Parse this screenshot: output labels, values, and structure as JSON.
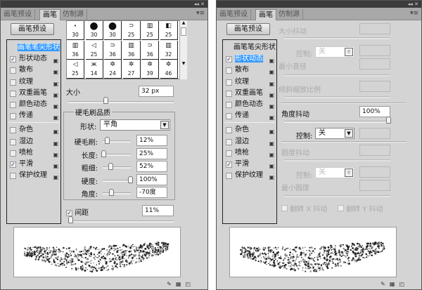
{
  "tabs": [
    "画笔预设",
    "画笔",
    "仿制源"
  ],
  "preset_button": "画笔预设",
  "list_items": [
    {
      "label": "画笔笔尖形状",
      "type": "head"
    },
    {
      "label": "形状动态",
      "checked": true
    },
    {
      "label": "散布",
      "checked": false
    },
    {
      "label": "纹理",
      "checked": false
    },
    {
      "label": "双重画笔",
      "checked": false
    },
    {
      "label": "颜色动态",
      "checked": false
    },
    {
      "label": "传递",
      "checked": false
    },
    {
      "label": "杂色",
      "checked": false
    },
    {
      "label": "湿边",
      "checked": false
    },
    {
      "label": "喷枪",
      "checked": false
    },
    {
      "label": "平滑",
      "checked": true
    },
    {
      "label": "保护纹理",
      "checked": false
    }
  ],
  "check_mark": "✓",
  "lock_glyph": "🔒",
  "brush_sizes": [
    "30",
    "30",
    "30",
    "25",
    "25",
    "25",
    "36",
    "25",
    "36",
    "36",
    "36",
    "32",
    "25",
    "14",
    "24",
    "27",
    "39",
    "46"
  ],
  "left": {
    "size_label": "大小",
    "size_value": "32 px",
    "size_pct": 0.35,
    "group_title": "硬毛刷品质",
    "shape_label": "形状:",
    "shape_value": "平角",
    "rows": [
      {
        "label": "硬毛刷:",
        "value": "12%",
        "pct": 0.12
      },
      {
        "label": "长度:",
        "value": "25%",
        "pct": 0.0
      },
      {
        "label": "粗细:",
        "value": "52%",
        "pct": 0.27
      },
      {
        "label": "硬度:",
        "value": "100%",
        "pct": 1.0
      },
      {
        "label": "角度:",
        "value": "-70度",
        "pct": 0.28
      }
    ],
    "spacing_label": "间距",
    "spacing_checked": true,
    "spacing_value": "11%",
    "spacing_pct": 0.02
  },
  "right": {
    "size_jitter": "大小抖动",
    "control_label": "控制:",
    "control_value": "关",
    "min_diameter": "最小直径",
    "tilt_scale": "倾斜缩放比例",
    "angle_jitter": "角度抖动",
    "angle_value": "100%",
    "angle_pct": 1.0,
    "angle_control_label": "控制:",
    "angle_control_value": "关",
    "roundness_jitter": "圆度抖动",
    "round_control_label": "控制:",
    "round_control_value": "关",
    "min_roundness": "最小圆度",
    "flip_x": "翻转 X 抖动",
    "flip_y": "翻转 Y 抖动"
  },
  "colors": {
    "panel": "#d4d4d4",
    "selected": "#3399ff",
    "titlebar": "#3c3c3c"
  }
}
